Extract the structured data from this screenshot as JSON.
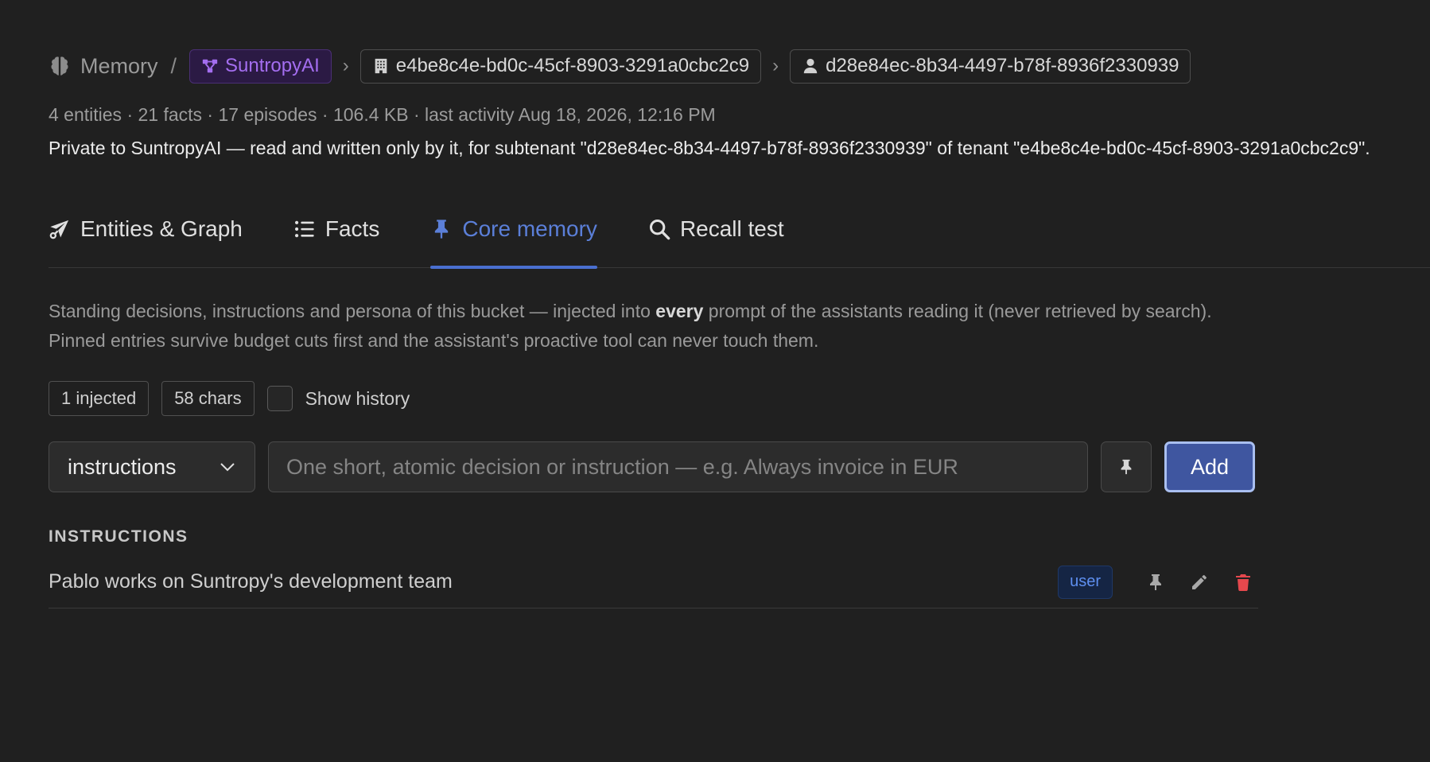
{
  "breadcrumb": {
    "root_label": "Memory",
    "slash": "/",
    "agent_label": "SuntropyAI",
    "separator": "›",
    "tenant_id": "e4be8c4e-bd0c-45cf-8903-3291a0cbc2c9",
    "subtenant_id": "d28e84ec-8b34-4497-b78f-8936f2330939",
    "icons": [
      "brain-icon",
      "agent-graph-icon",
      "building-icon",
      "user-icon"
    ],
    "agent_color": "#a46ef0"
  },
  "stats": "4 entities · 21 facts · 17 episodes · 106.4 KB · last activity Aug 18, 2026, 12:16 PM",
  "privacy": "Private to SuntropyAI — read and written only by it, for subtenant \"d28e84ec-8b34-4497-b78f-8936f2330939\" of tenant \"e4be8c4e-bd0c-45cf-8903-3291a0cbc2c9\".",
  "tabs": [
    {
      "label": "Entities & Graph",
      "icon": "share-nodes-icon"
    },
    {
      "label": "Facts",
      "icon": "list-icon"
    },
    {
      "label": "Core memory",
      "icon": "pin-icon",
      "active": true
    },
    {
      "label": "Recall test",
      "icon": "search-icon"
    }
  ],
  "accent_color": "#4a6fd0",
  "description": {
    "part1": "Standing decisions, instructions and persona of this bucket — injected into ",
    "bold": "every",
    "part2": " prompt of the assistants reading it (never retrieved by search). Pinned entries survive budget cuts first and the assistant's proactive tool can never touch them."
  },
  "meta": {
    "injected": "1 injected",
    "chars": "58 chars",
    "show_history_label": "Show history",
    "show_history_checked": false
  },
  "form": {
    "kind_selected": "instructions",
    "input_value": "",
    "input_placeholder": "One short, atomic decision or instruction — e.g. Always invoice in EUR",
    "add_label": "Add"
  },
  "sections": [
    {
      "heading": "INSTRUCTIONS",
      "entries": [
        {
          "text": "Pablo works on Suntropy's development team",
          "source": "user"
        }
      ]
    }
  ],
  "delete_color": "#e5484d"
}
